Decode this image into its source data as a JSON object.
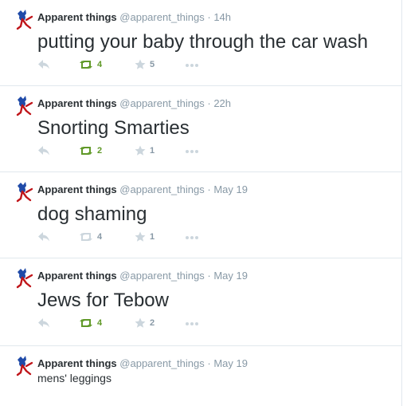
{
  "tweets": [
    {
      "name": "Apparent things",
      "handle": "@apparent_things",
      "sep": "·",
      "time": "14h",
      "text": "putting your baby through the car wash",
      "retweets": "4",
      "favorites": "5",
      "retweeted": true
    },
    {
      "name": "Apparent things",
      "handle": "@apparent_things",
      "sep": "·",
      "time": "22h",
      "text": "Snorting Smarties",
      "retweets": "2",
      "favorites": "1",
      "retweeted": true
    },
    {
      "name": "Apparent things",
      "handle": "@apparent_things",
      "sep": "·",
      "time": "May 19",
      "text": "dog shaming",
      "retweets": "4",
      "favorites": "1",
      "retweeted": false
    },
    {
      "name": "Apparent things",
      "handle": "@apparent_things",
      "sep": "·",
      "time": "May 19",
      "text": "Jews for Tebow",
      "retweets": "4",
      "favorites": "2",
      "retweeted": true
    },
    {
      "name": "Apparent things",
      "handle": "@apparent_things",
      "sep": "·",
      "time": "May 19",
      "text": "mens' leggings"
    }
  ],
  "icons": {
    "avatar": "cartoon-bird-avatar",
    "reply": "reply-arrow-icon",
    "retweet": "retweet-icon",
    "favorite": "star-icon",
    "more": "more-dots-icon"
  },
  "colors": {
    "name": "#292f33",
    "meta": "#8899a6",
    "icon": "#ccd6dd",
    "retweeted": "#609928",
    "divider": "#e1e8ed"
  }
}
